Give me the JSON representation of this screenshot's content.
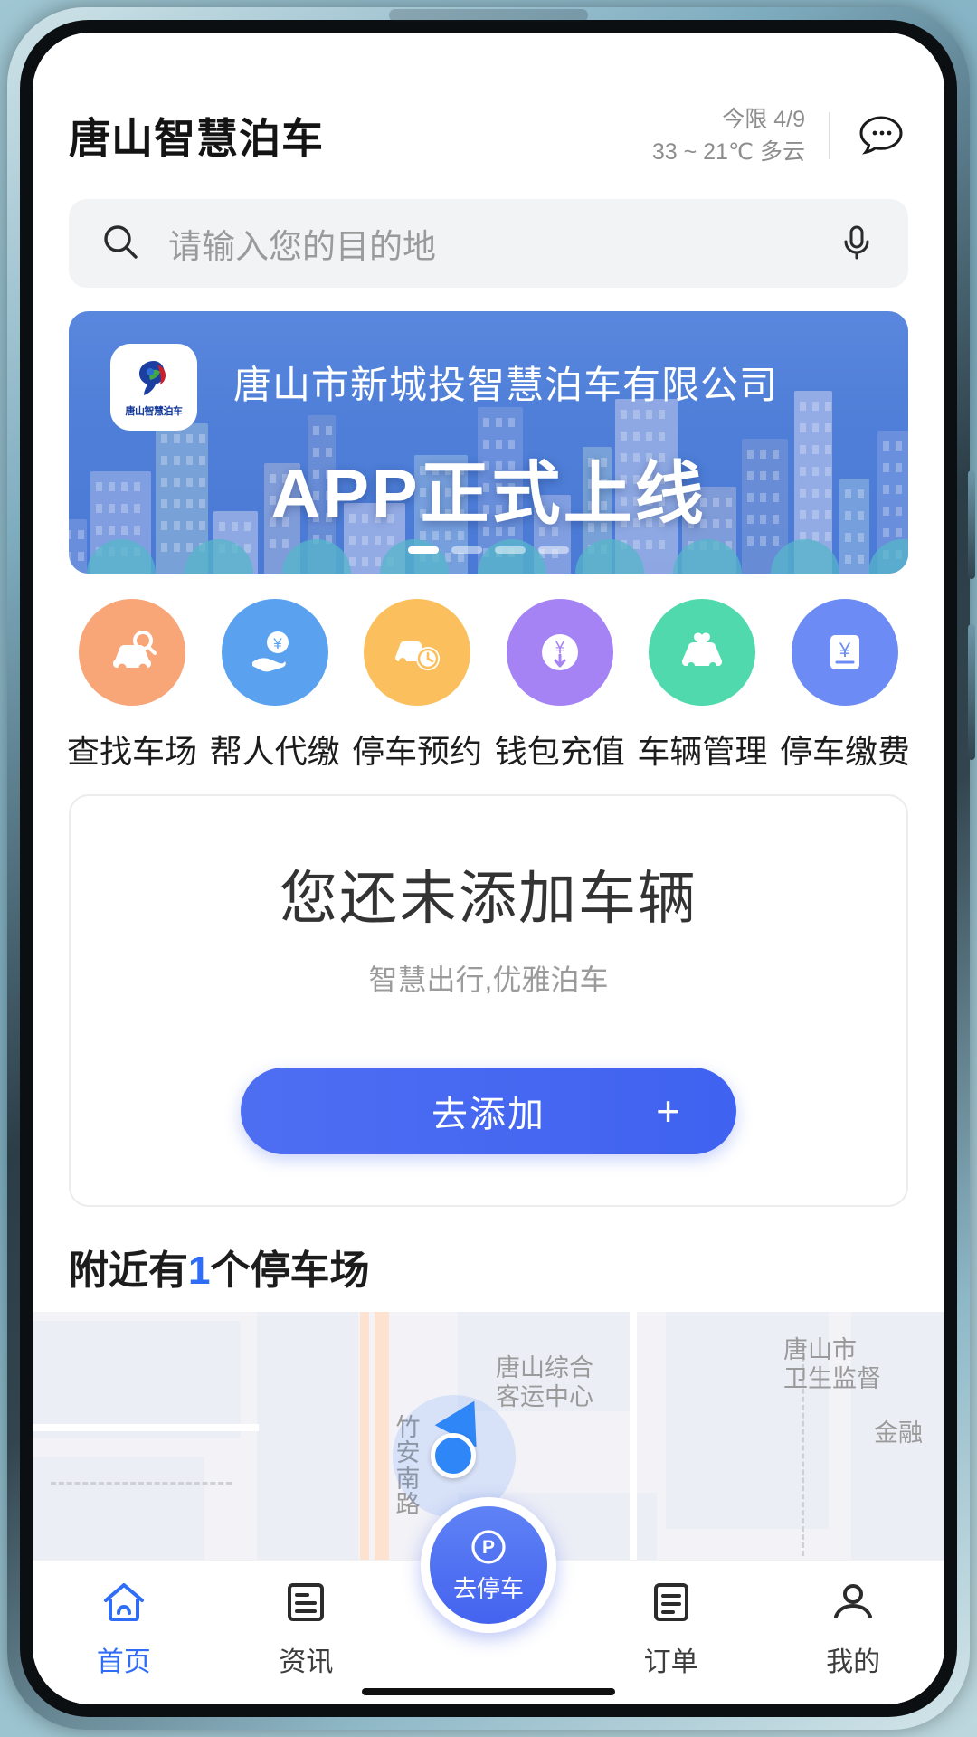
{
  "header": {
    "title": "唐山智慧泊车",
    "weather_limit": "今限 4/9",
    "weather_temp": "33 ~ 21℃ 多云",
    "chat_icon": "chat-bubble-icon"
  },
  "search": {
    "placeholder": "请输入您的目的地",
    "search_icon": "search-icon",
    "mic_icon": "microphone-icon"
  },
  "banner": {
    "logo_text": "唐山智慧泊车",
    "company": "唐山市新城投智慧泊车有限公司",
    "headline": "APP正式上线",
    "dots_total": 4,
    "dots_active_index": 0,
    "bg_color": "#4f7fd8"
  },
  "quick_actions": [
    {
      "label": "查找车场",
      "icon": "car-search-icon",
      "color": "#f8a578"
    },
    {
      "label": "帮人代缴",
      "icon": "hand-yuan-icon",
      "color": "#5aa2ef"
    },
    {
      "label": "停车预约",
      "icon": "car-clock-icon",
      "color": "#fbc05d"
    },
    {
      "label": "钱包充值",
      "icon": "wallet-topup-icon",
      "color": "#a683f5"
    },
    {
      "label": "车辆管理",
      "icon": "car-manage-icon",
      "color": "#4fd9ac"
    },
    {
      "label": "停车缴费",
      "icon": "parking-pay-icon",
      "color": "#6d8bf4"
    }
  ],
  "vehicle_card": {
    "title": "您还未添加车辆",
    "subtitle": "智慧出行,优雅泊车",
    "button_label": "去添加",
    "button_plus": "+",
    "button_color": "#4463ef"
  },
  "nearby": {
    "prefix": "附近有",
    "count": "1",
    "suffix": "个停车场",
    "count_color": "#2f6df6"
  },
  "map": {
    "labels": [
      "唐山综合",
      "客运中心",
      "唐山市",
      "卫生监督",
      "竹安南路",
      "金融"
    ]
  },
  "bottom_nav": {
    "items": [
      {
        "label": "首页",
        "icon": "home-icon",
        "active": true
      },
      {
        "label": "资讯",
        "icon": "news-icon",
        "active": false
      },
      {
        "label": "订单",
        "icon": "order-icon",
        "active": false
      },
      {
        "label": "我的",
        "icon": "user-icon",
        "active": false
      }
    ],
    "center": {
      "label": "去停车",
      "icon": "parking-p-icon"
    },
    "active_color": "#2f6df6"
  }
}
